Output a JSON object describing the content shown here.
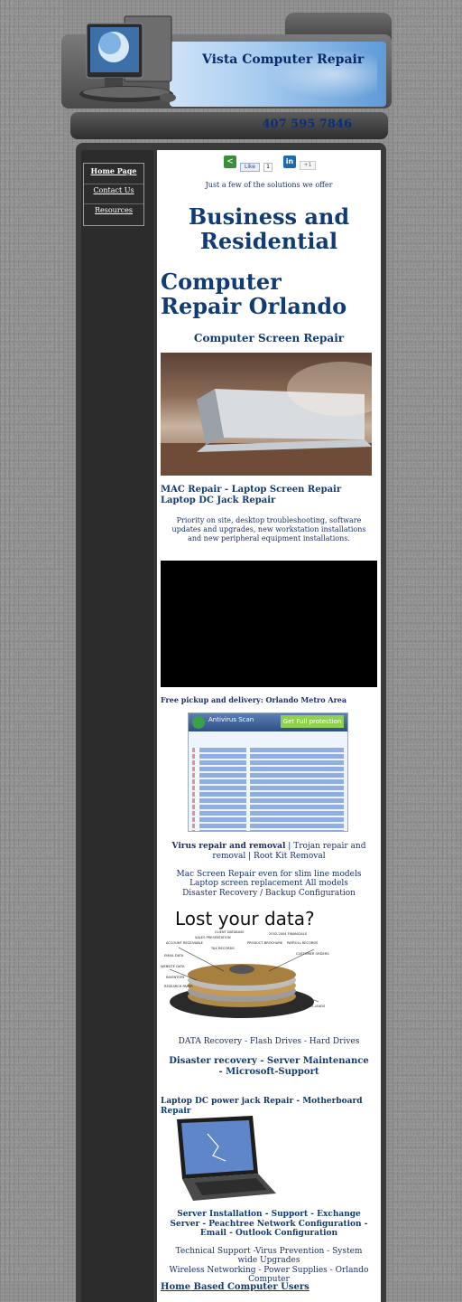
{
  "header": {
    "site_title": "Vista Computer Repair",
    "phone": "407 595 7846"
  },
  "nav": {
    "items": [
      {
        "label": "Home Page"
      },
      {
        "label": "Contact Us"
      },
      {
        "label": "Resources"
      }
    ]
  },
  "social": {
    "fb_like": "Like",
    "fb_count": "1",
    "linkedin": "in",
    "gplus": "+1"
  },
  "main": {
    "tagline": "Just a few of the solutions we offer",
    "heading1": "Business and Residential",
    "heading2": "Computer Repair Orlando",
    "subheading1": "Computer Screen Repair",
    "mac_repair": "MAC Repair - Laptop Screen Repair Laptop DC Jack Repair",
    "priority": "Priority on site, desktop troubleshooting, software updates and upgrades, new workstation installations and new peripheral equipment installations.",
    "pickup": "Free pickup and delivery: Orlando Metro Area",
    "virus_bold": "Virus repair and removal",
    "virus_rest": " | Trojan repair and removal | Root Kit Removal",
    "mac_screen": "Mac Screen Repair even for slim line models",
    "laptop_screen": "Laptop screen replacement All models",
    "disaster_backup": "Disaster Recovery / Backup Configuration",
    "lost_data_title": "Lost your data?",
    "data_recovery": "DATA Recovery - Flash Drives - Hard Drives",
    "disaster_server": "Disaster recovery - Server Maintenance - Microsoft-Support",
    "dc_power": "Laptop DC power jack Repair - Motherboard Repair",
    "server_install": "Server Installation - Support - Exchange Server - Peachtree Network Configuration - Email - Outlook Configuration",
    "tech_support": "Technical Support -Virus Prevention - System wide Upgrades",
    "wireless": "Wireless Networking - Power Supplies - Orlando Computer",
    "home_users": "Home Based Computer Users"
  },
  "antivirus": {
    "app_name": "Antivirus Scan",
    "promo": "Get Full protection"
  },
  "lost_data_labels": [
    "CLIENT DATABASE",
    "SALES PRESENTATION",
    "2002-2004 FINANCIALS",
    "ACCOUNT RECEIVABLE",
    "PRODUCT BROCHURE",
    "PAYROLL RECORDS",
    "TAX RECORDS",
    "EMAIL DATA",
    "CUSTOMER ORDERS",
    "WEBSITE DATA",
    "INVENTORY",
    "RESEARCH PAPER",
    "SALES LEADS"
  ],
  "colors": {
    "heading": "#103b75",
    "text": "#1b2f6b",
    "frame": "#3a3a3a",
    "sidebar": "#2c2c2c"
  }
}
